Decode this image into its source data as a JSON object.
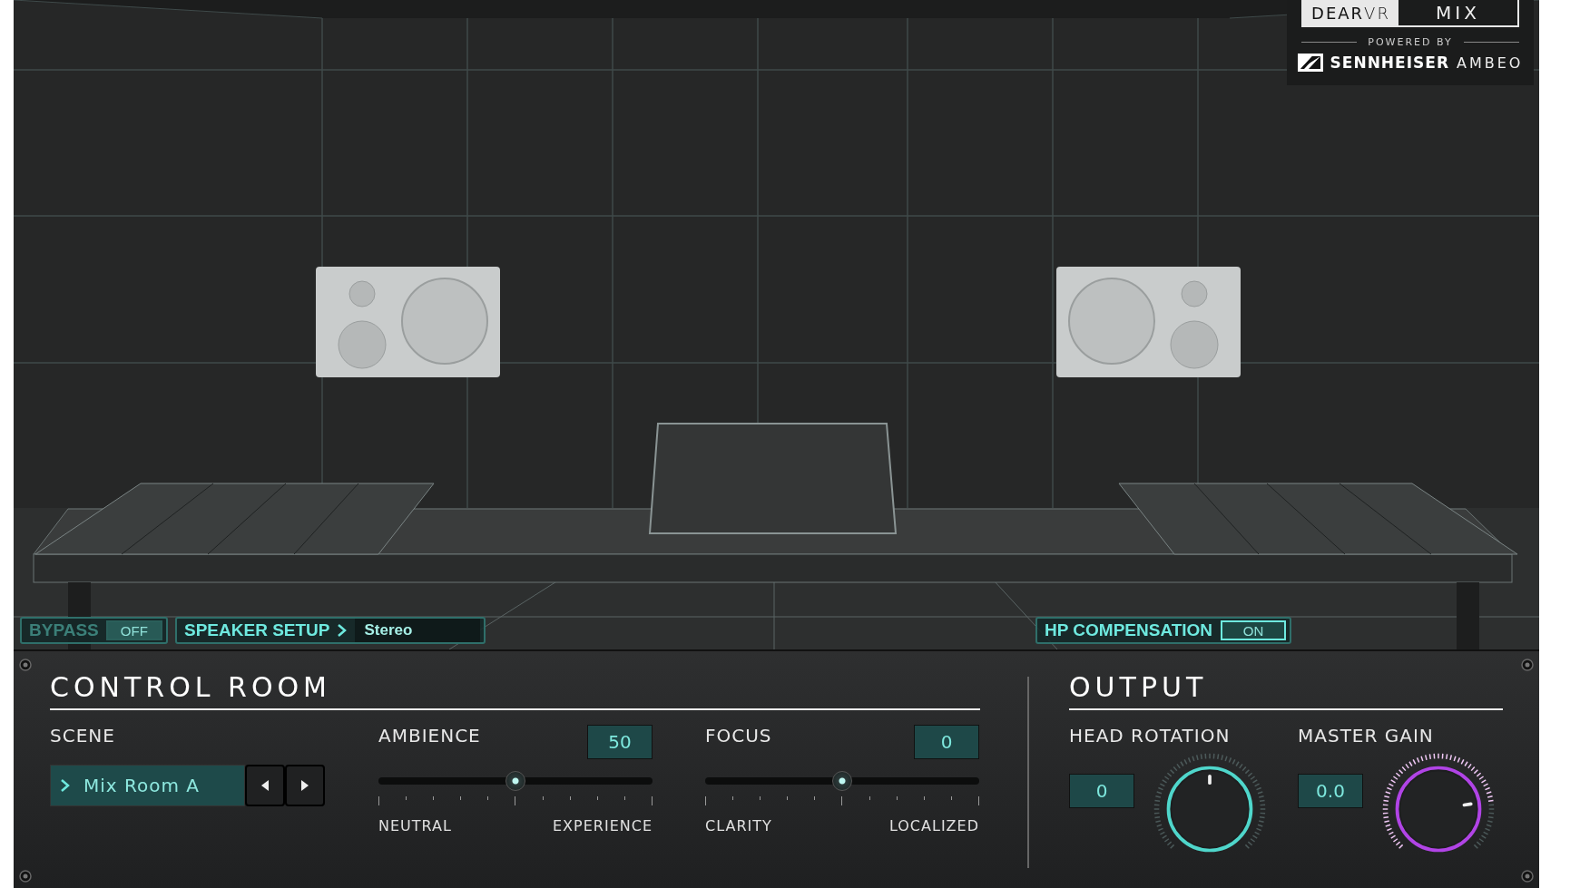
{
  "logo": {
    "product": "**DEAR**VR",
    "edition": "MIX",
    "powered_by": "POWERED BY",
    "brand": "SENNHEISER",
    "sub_brand": "AMBEO"
  },
  "top_bar": {
    "bypass": {
      "label": "BYPASS",
      "value": "OFF",
      "on": false
    },
    "speaker_setup": {
      "label": "SPEAKER SETUP",
      "value": "Stereo"
    },
    "hp_compensation": {
      "label": "HP COMPENSATION",
      "value": "ON",
      "on": true
    }
  },
  "control_room": {
    "title": "CONTROL ROOM",
    "scene": {
      "label": "SCENE",
      "value": "Mix Room A"
    },
    "sliders": [
      {
        "label": "AMBIENCE",
        "value": "50",
        "level": 0.5,
        "left_label": "NEUTRAL",
        "right_label": "EXPERIENCE"
      },
      {
        "label": "FOCUS",
        "value": "0",
        "level": 0.5,
        "left_label": "CLARITY",
        "right_label": "LOCALIZED"
      }
    ]
  },
  "output": {
    "title": "OUTPUT",
    "knobs": [
      {
        "label": "HEAD ROTATION",
        "value": "0",
        "level": 0.5,
        "color": "#4fd6cb"
      },
      {
        "label": "MASTER GAIN",
        "value": "0.0",
        "level": 0.8,
        "color": "#b144e6"
      }
    ]
  }
}
